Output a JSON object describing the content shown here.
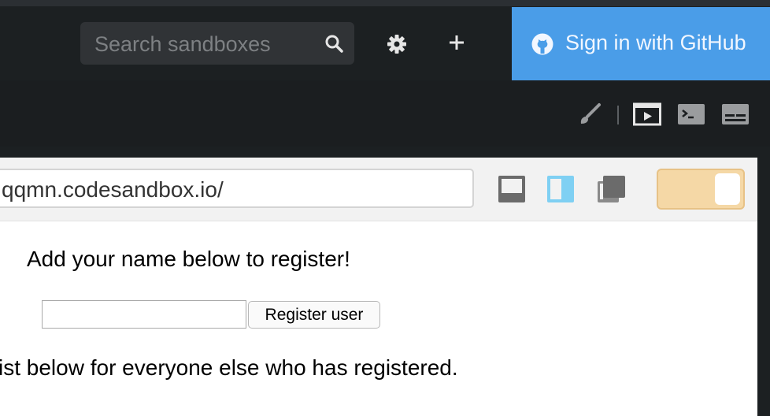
{
  "header": {
    "search_placeholder": "Search sandboxes",
    "signin_label": "Sign in with GitHub",
    "icons": [
      "search-icon",
      "gear-icon",
      "plus-icon",
      "github-icon"
    ]
  },
  "toolbar": {
    "icons": [
      "brush-icon",
      "preview-icon",
      "terminal-icon",
      "console-icon"
    ]
  },
  "browser": {
    "url": "qqmn.codesandbox.io/",
    "icons": [
      "bottom-pane-icon",
      "right-pane-icon",
      "new-window-icon"
    ],
    "toggle_color": "#f5d8a6"
  },
  "page": {
    "heading": "Add your name below to register!",
    "input_value": "",
    "button_label": "Register user",
    "list_text": "ist below for everyone else who has registered."
  },
  "colors": {
    "accent": "#4a9de8",
    "header_bg": "#1c2022"
  }
}
